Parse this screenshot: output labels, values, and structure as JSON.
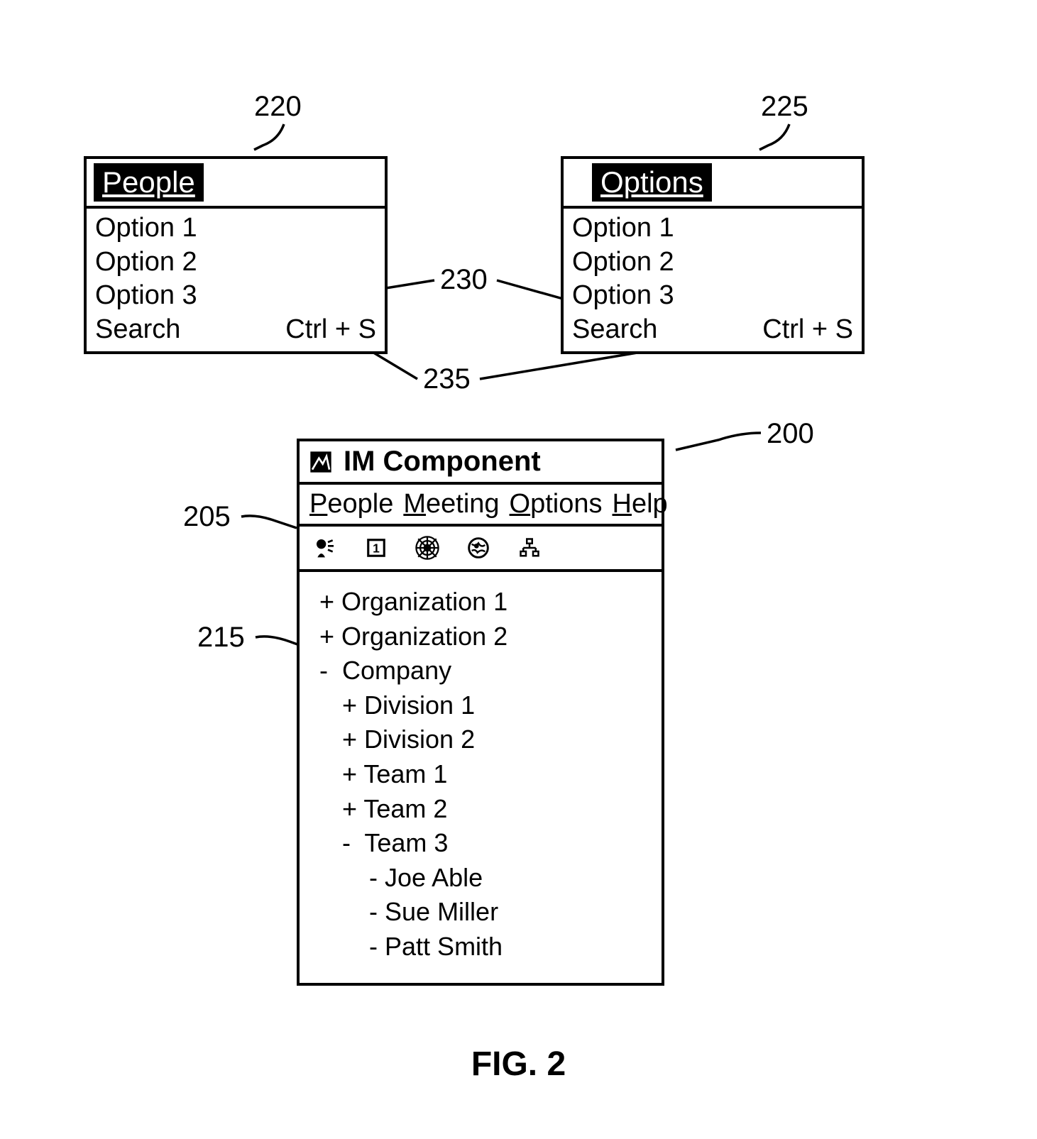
{
  "refs": {
    "r220": "220",
    "r225": "225",
    "r230": "230",
    "r235": "235",
    "r200": "200",
    "r205": "205",
    "r215": "215"
  },
  "menu_people": {
    "title": "People",
    "items": [
      {
        "label": "Option 1",
        "accel": ""
      },
      {
        "label": "Option 2",
        "accel": ""
      },
      {
        "label": "Option 3",
        "accel": ""
      },
      {
        "label": "Search",
        "accel": "Ctrl + S"
      }
    ]
  },
  "menu_options": {
    "title": "Options",
    "items": [
      {
        "label": "Option 1",
        "accel": ""
      },
      {
        "label": "Option 2",
        "accel": ""
      },
      {
        "label": "Option 3",
        "accel": ""
      },
      {
        "label": "Search",
        "accel": "Ctrl + S"
      }
    ]
  },
  "im_window": {
    "title": "IM Component",
    "menubar": {
      "people": "People",
      "meeting": "Meeting",
      "options": "Options",
      "help": "Help"
    },
    "toolbar_icons": [
      "speak-icon",
      "calendar-icon",
      "web-icon",
      "globe-icon",
      "network-icon"
    ],
    "tree": [
      {
        "level": 1,
        "prefix": "+",
        "label": "Organization 1"
      },
      {
        "level": 1,
        "prefix": "+",
        "label": "Organization 2"
      },
      {
        "level": 1,
        "prefix": "-",
        "label": "Company"
      },
      {
        "level": 2,
        "prefix": "+",
        "label": "Division 1"
      },
      {
        "level": 2,
        "prefix": "+",
        "label": "Division 2"
      },
      {
        "level": 2,
        "prefix": "+",
        "label": "Team 1"
      },
      {
        "level": 2,
        "prefix": "+",
        "label": "Team 2"
      },
      {
        "level": 2,
        "prefix": "-",
        "label": "Team 3"
      },
      {
        "level": 3,
        "prefix": "-",
        "label": "Joe Able"
      },
      {
        "level": 3,
        "prefix": "-",
        "label": "Sue Miller"
      },
      {
        "level": 3,
        "prefix": "-",
        "label": "Patt Smith"
      }
    ]
  },
  "caption": "FIG. 2"
}
